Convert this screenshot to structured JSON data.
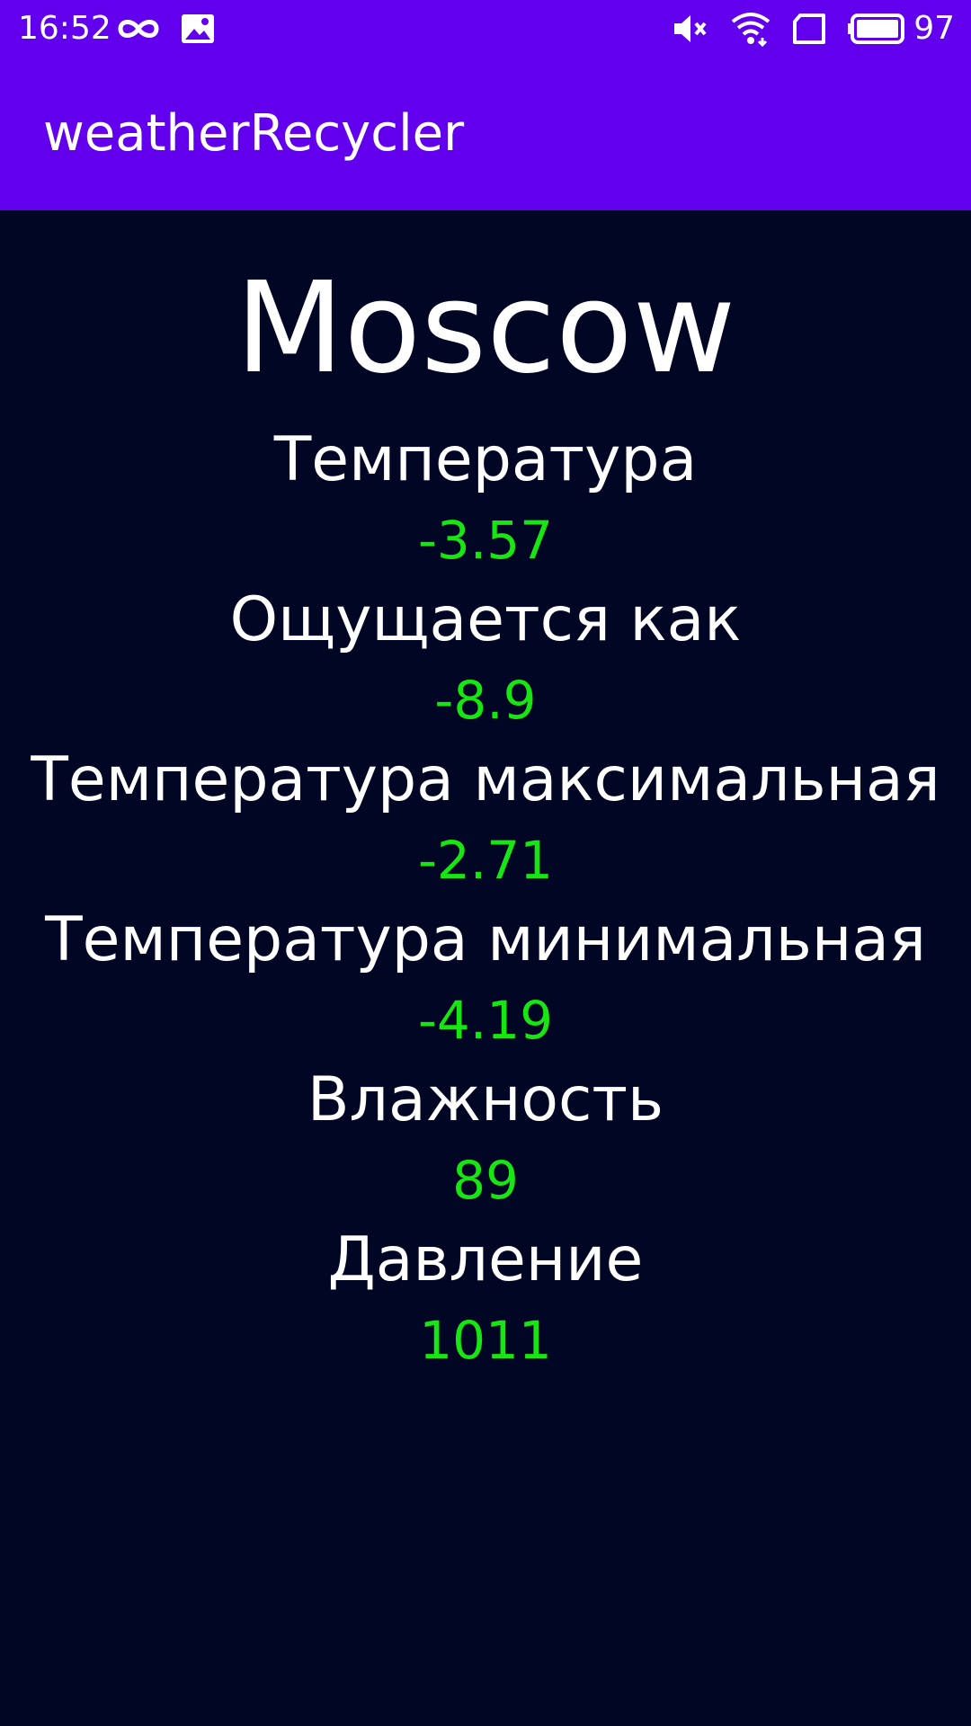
{
  "status_bar": {
    "time": "16:52",
    "left_icons": [
      "infinity-icon",
      "image-icon"
    ],
    "right_icons": [
      "mute-icon",
      "wifi-icon",
      "sim-icon",
      "battery-icon"
    ],
    "battery_level": "97"
  },
  "app_bar": {
    "title": "weatherRecycler"
  },
  "weather": {
    "city": "Moscow",
    "rows": [
      {
        "label": "Температура",
        "value": "-3.57"
      },
      {
        "label": "Ощущается как",
        "value": "-8.9"
      },
      {
        "label": "Температура максимальная",
        "value": "-2.71"
      },
      {
        "label": "Температура минимальная",
        "value": "-4.19"
      },
      {
        "label": "Влажность",
        "value": "89"
      },
      {
        "label": "Давление",
        "value": "1011"
      }
    ]
  },
  "colors": {
    "primary": "#6200ee",
    "background": "#000624",
    "label_text": "#ffffff",
    "value_text": "#18e612"
  }
}
